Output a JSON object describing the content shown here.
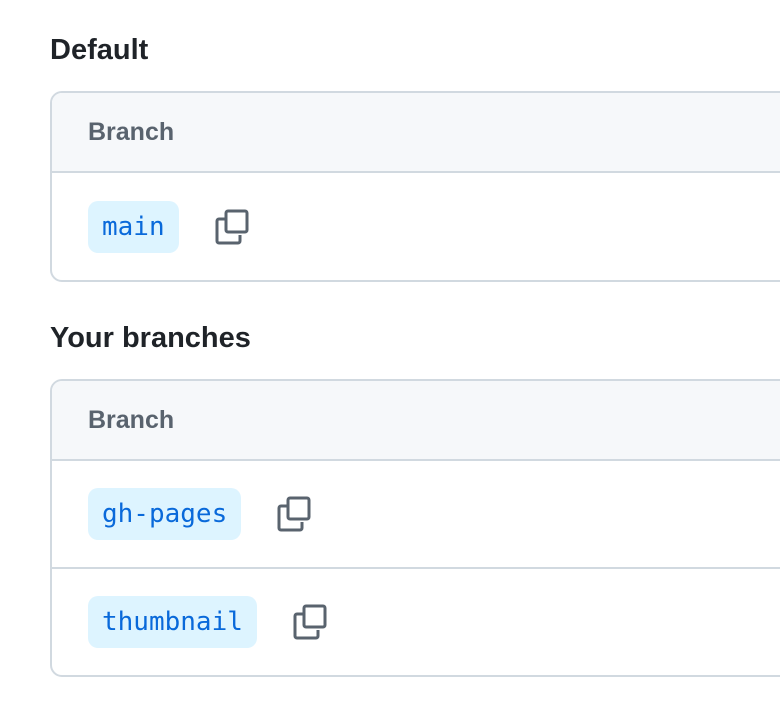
{
  "default_section": {
    "title": "Default",
    "header": "Branch",
    "branches": [
      {
        "name": "main",
        "copy_icon": "copy-icon"
      }
    ]
  },
  "your_branches_section": {
    "title": "Your branches",
    "header": "Branch",
    "branches": [
      {
        "name": "gh-pages",
        "copy_icon": "copy-icon"
      },
      {
        "name": "thumbnail",
        "copy_icon": "copy-icon"
      }
    ]
  },
  "colors": {
    "pill_bg": "#ddf4ff",
    "pill_text": "#0969da",
    "border": "#d1d9e0",
    "header_bg": "#f6f8fa",
    "header_text": "#59636e"
  }
}
